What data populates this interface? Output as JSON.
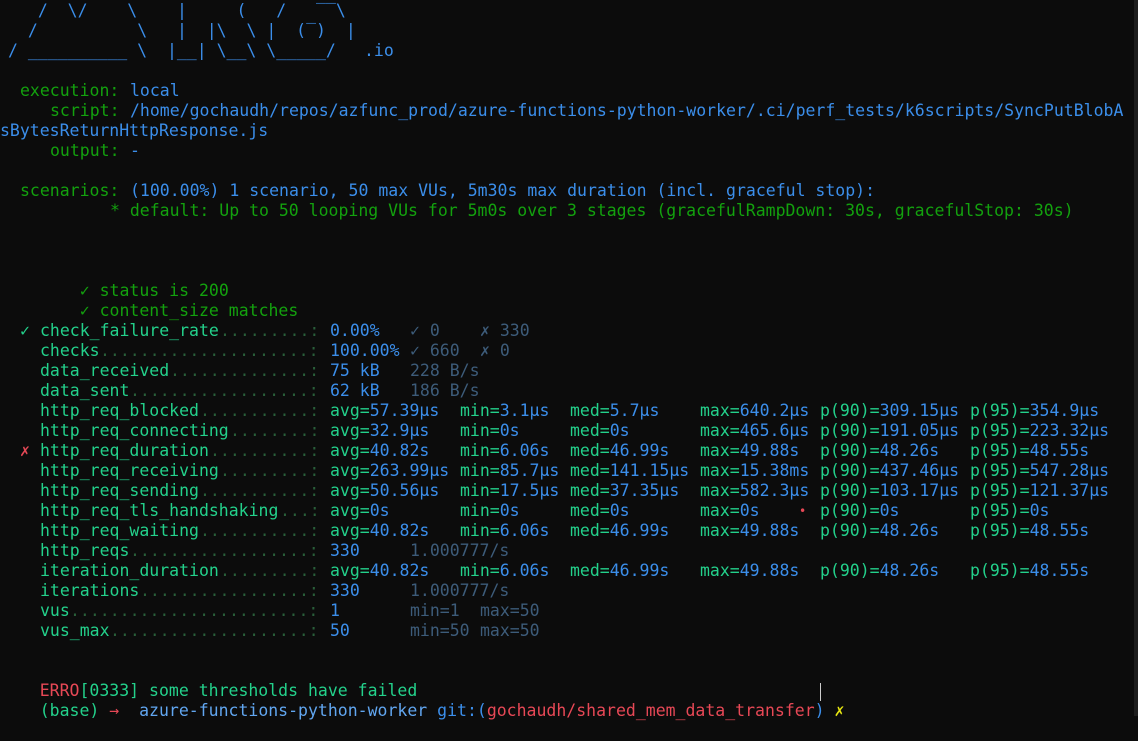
{
  "logo_lines": [
    "  /  \\/    \\    |     (   /   ‾‾\\",
    " /          \\   |  |\\  \\ |  (‾)  |",
    "/ __________ \\  |__| \\__\\ \\_____/"
  ],
  "logo_suffix": ".io",
  "execution": {
    "label": "execution:",
    "value": "local",
    "script_label": "script:",
    "script_value": "/home/gochaudh/repos/azfunc_prod/azure-functions-python-worker/.ci/perf_tests/k6scripts/SyncPutBlobA",
    "script_value_wrap": "sBytesReturnHttpResponse.js",
    "output_label": "output:",
    "output_value": "-"
  },
  "scenarios": {
    "label": "scenarios:",
    "value": "(100.00%) 1 scenario, 50 max VUs, 5m30s max duration (incl. graceful stop):",
    "detail": "* default: Up to 50 looping VUs for 5m0s over 3 stages (gracefulRampDown: 30s, gracefulStop: 30s)"
  },
  "checks": [
    {
      "mark": "✓",
      "text": "status is 200"
    },
    {
      "mark": "✓",
      "text": "content_size matches"
    }
  ],
  "metrics": [
    {
      "mark": "✓",
      "name": "check_failure_rate",
      "dots": ".........:",
      "cols": [
        "0.00%",
        "✓ 0",
        "✗ 330"
      ]
    },
    {
      "mark": "",
      "name": "checks",
      "dots": ".....................:",
      "cols": [
        "100.00%",
        "✓ 660",
        "✗ 0"
      ]
    },
    {
      "mark": "",
      "name": "data_received",
      "dots": "..............:",
      "cols": [
        "75 kB",
        "228 B/s"
      ]
    },
    {
      "mark": "",
      "name": "data_sent",
      "dots": "..................:",
      "cols": [
        "62 kB",
        "186 B/s"
      ]
    },
    {
      "mark": "",
      "name": "http_req_blocked",
      "dots": "...........:",
      "cols": [
        "avg=57.39µs",
        "min=3.1µs",
        "med=5.7µs",
        "max=640.2µs",
        "p(90)=309.15µs",
        "p(95)=354.9µs"
      ]
    },
    {
      "mark": "",
      "name": "http_req_connecting",
      "dots": "........:",
      "cols": [
        "avg=32.9µs",
        "min=0s",
        "med=0s",
        "max=465.6µs",
        "p(90)=191.05µs",
        "p(95)=223.32µs"
      ]
    },
    {
      "mark": "✗",
      "name": "http_req_duration",
      "dots": "..........:",
      "cols": [
        "avg=40.82s",
        "min=6.06s",
        "med=46.99s",
        "max=49.88s",
        "p(90)=48.26s",
        "p(95)=48.55s"
      ]
    },
    {
      "mark": "",
      "name": "http_req_receiving",
      "dots": ".........:",
      "cols": [
        "avg=263.99µs",
        "min=85.7µs",
        "med=141.15µs",
        "max=15.38ms",
        "p(90)=437.46µs",
        "p(95)=547.28µs"
      ]
    },
    {
      "mark": "",
      "name": "http_req_sending",
      "dots": "...........:",
      "cols": [
        "avg=50.56µs",
        "min=17.5µs",
        "med=37.35µs",
        "max=582.3µs",
        "p(90)=103.17µs",
        "p(95)=121.37µs"
      ]
    },
    {
      "mark": "",
      "name": "http_req_tls_handshaking",
      "dots": "...:",
      "cols": [
        "avg=0s",
        "min=0s",
        "med=0s",
        "max=0s",
        "p(90)=0s",
        "p(95)=0s"
      ]
    },
    {
      "mark": "",
      "name": "http_req_waiting",
      "dots": "...........:",
      "cols": [
        "avg=40.82s",
        "min=6.06s",
        "med=46.99s",
        "max=49.88s",
        "p(90)=48.26s",
        "p(95)=48.55s"
      ]
    },
    {
      "mark": "",
      "name": "http_reqs",
      "dots": "..................:",
      "cols": [
        "330",
        "1.000777/s"
      ]
    },
    {
      "mark": "",
      "name": "iteration_duration",
      "dots": ".........:",
      "cols": [
        "avg=40.82s",
        "min=6.06s",
        "med=46.99s",
        "max=49.88s",
        "p(90)=48.26s",
        "p(95)=48.55s"
      ]
    },
    {
      "mark": "",
      "name": "iterations",
      "dots": ".................:",
      "cols": [
        "330",
        "1.000777/s"
      ]
    },
    {
      "mark": "",
      "name": "vus",
      "dots": "........................:",
      "cols": [
        "1",
        "min=1",
        "max=50"
      ]
    },
    {
      "mark": "",
      "name": "vus_max",
      "dots": "....................:",
      "cols": [
        "50",
        "min=50",
        "max=50"
      ]
    }
  ],
  "error": {
    "prefix": "ERRO",
    "rest": "[0333] some thresholds have failed"
  },
  "prompt": {
    "env": "(base)",
    "arrow": "→",
    "dir": "azure-functions-python-worker",
    "git_label": "git:(",
    "branch": "gochaudh/shared_mem_data_transfer",
    "git_close": ")",
    "dirty": "✗"
  },
  "colors": {
    "background": "#0c0c0c",
    "blue": "#3b8eea",
    "green": "#23d18b",
    "dim": "#3d5c7a",
    "red": "#e74856",
    "yellow": "#e5e510"
  }
}
